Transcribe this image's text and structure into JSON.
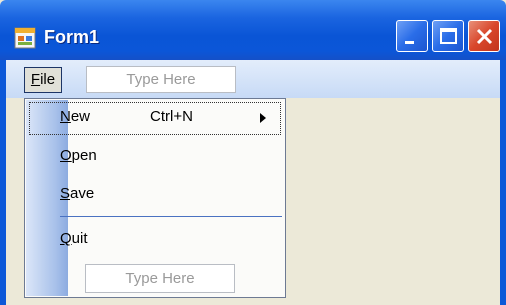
{
  "window": {
    "title": "Form1"
  },
  "menu": {
    "file_label": "File",
    "file_accel": "F",
    "type_here": "Type Here"
  },
  "file_menu": {
    "items": [
      {
        "label": "New",
        "accel": "N",
        "shortcut": "Ctrl+N",
        "has_submenu": true
      },
      {
        "label": "Open",
        "accel": "O"
      },
      {
        "label": "Save",
        "accel": "S"
      },
      {
        "label": "Quit",
        "accel": "Q"
      }
    ],
    "type_here": "Type Here"
  },
  "icons": {
    "app": "app-icon",
    "minimize": "minimize-icon",
    "maximize": "maximize-icon",
    "close": "close-icon",
    "submenu": "submenu-arrow-icon"
  }
}
